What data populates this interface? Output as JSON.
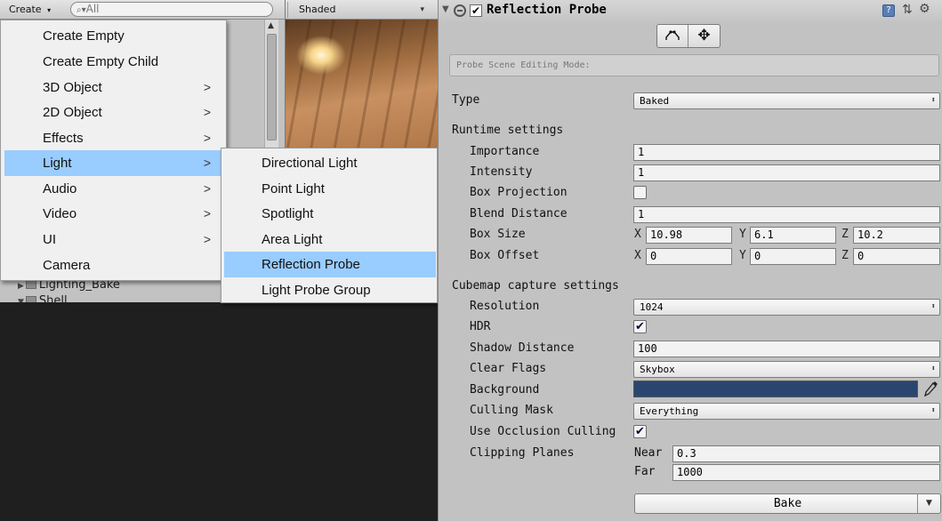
{
  "hierarchy": {
    "create_label": "Create",
    "search_placeholder": "All",
    "rows": [
      "Lighting_Bake",
      "Shell"
    ]
  },
  "scene": {
    "shading_mode": "Shaded"
  },
  "create_menu": {
    "items": [
      {
        "label": "Create Empty",
        "has_submenu": false
      },
      {
        "label": "Create Empty Child",
        "has_submenu": false
      },
      {
        "label": "3D Object",
        "has_submenu": true
      },
      {
        "label": "2D Object",
        "has_submenu": true
      },
      {
        "label": "Effects",
        "has_submenu": true
      },
      {
        "label": "Light",
        "has_submenu": true,
        "highlighted": true
      },
      {
        "label": "Audio",
        "has_submenu": true
      },
      {
        "label": "Video",
        "has_submenu": true
      },
      {
        "label": "UI",
        "has_submenu": true
      },
      {
        "label": "Camera",
        "has_submenu": false
      }
    ],
    "light_submenu": [
      {
        "label": "Directional Light"
      },
      {
        "label": "Point Light"
      },
      {
        "label": "Spotlight"
      },
      {
        "label": "Area Light"
      },
      {
        "label": "Reflection Probe",
        "highlighted": true
      },
      {
        "label": "Light Probe Group"
      }
    ]
  },
  "inspector": {
    "component_title": "Reflection Probe",
    "component_enabled": true,
    "probe_mode_placeholder": "Probe Scene Editing Mode:",
    "type_label": "Type",
    "type_value": "Baked",
    "runtime_header": "Runtime settings",
    "importance_label": "Importance",
    "importance_value": "1",
    "intensity_label": "Intensity",
    "intensity_value": "1",
    "box_projection_label": "Box Projection",
    "box_projection_checked": false,
    "blend_distance_label": "Blend Distance",
    "blend_distance_value": "1",
    "box_size_label": "Box Size",
    "box_size": {
      "x": "10.98",
      "y": "6.1",
      "z": "10.2"
    },
    "box_offset_label": "Box Offset",
    "box_offset": {
      "x": "0",
      "y": "0",
      "z": "0"
    },
    "axis_labels": {
      "x": "X",
      "y": "Y",
      "z": "Z"
    },
    "cubemap_header": "Cubemap capture settings",
    "resolution_label": "Resolution",
    "resolution_value": "1024",
    "hdr_label": "HDR",
    "hdr_checked": true,
    "shadow_distance_label": "Shadow Distance",
    "shadow_distance_value": "100",
    "clear_flags_label": "Clear Flags",
    "clear_flags_value": "Skybox",
    "background_label": "Background",
    "background_color": "#2a4670",
    "culling_mask_label": "Culling Mask",
    "culling_mask_value": "Everything",
    "occlusion_label": "Use Occlusion Culling",
    "occlusion_checked": true,
    "clipping_label": "Clipping Planes",
    "near_label": "Near",
    "near_value": "0.3",
    "far_label": "Far",
    "far_value": "1000",
    "bake_label": "Bake"
  },
  "colors": {
    "menu_highlight": "#99ccff",
    "panel_bg": "#c2c2c2",
    "dark_bg": "#1f1f1f"
  }
}
